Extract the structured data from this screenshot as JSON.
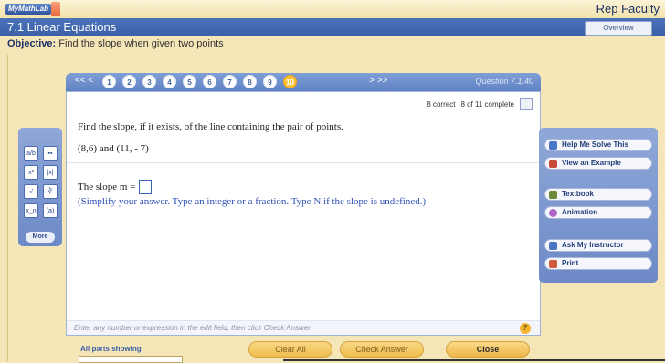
{
  "header": {
    "logo_text": "MyMathLab",
    "user": "Rep Faculty"
  },
  "section": {
    "title": "7.1 Linear Equations",
    "overview_button": "Overview"
  },
  "objective": {
    "label": "Objective:",
    "text": "Find the slope when given two points"
  },
  "nav": {
    "left_arrows": "<< <",
    "right_arrows": "> >>",
    "question_numbers": [
      "1",
      "2",
      "3",
      "4",
      "5",
      "6",
      "7",
      "8",
      "9",
      "10"
    ],
    "current_index": 9,
    "question_label": "Question 7.1.40"
  },
  "status": {
    "correct": "8 correct",
    "complete": "8 of 11 complete"
  },
  "problem": {
    "statement": "Find the slope, if it exists, of the line containing the pair of points.",
    "points": "(8,6) and (11, - 7)",
    "answer_prefix": "The slope m =",
    "instructions": "(Simplify your answer. Type an integer or a fraction. Type N if the slope is undefined.)"
  },
  "hint": {
    "text": "Enter any number or expression in the edit field, then click Check Answer.",
    "help_symbol": "?"
  },
  "tools": {
    "buttons": [
      "a/b",
      "▪▪",
      "x²",
      "|x|",
      "√",
      "∛",
      "x_n",
      "(a)"
    ],
    "more_label": "More"
  },
  "side_panel": {
    "help_me_solve": "Help Me Solve This",
    "view_example": "View an Example",
    "textbook": "Textbook",
    "animation": "Animation",
    "ask_instructor": "Ask My Instructor",
    "print": "Print"
  },
  "bottom": {
    "parts_label": "All parts showing",
    "clear_all": "Clear All",
    "check_answer": "Check Answer",
    "close": "Close"
  },
  "colors": {
    "accent_blue": "#3a5fa6",
    "answer_blue": "#2e4fb8",
    "button_gold": "#efbd4e",
    "background": "#f5e6b8"
  }
}
